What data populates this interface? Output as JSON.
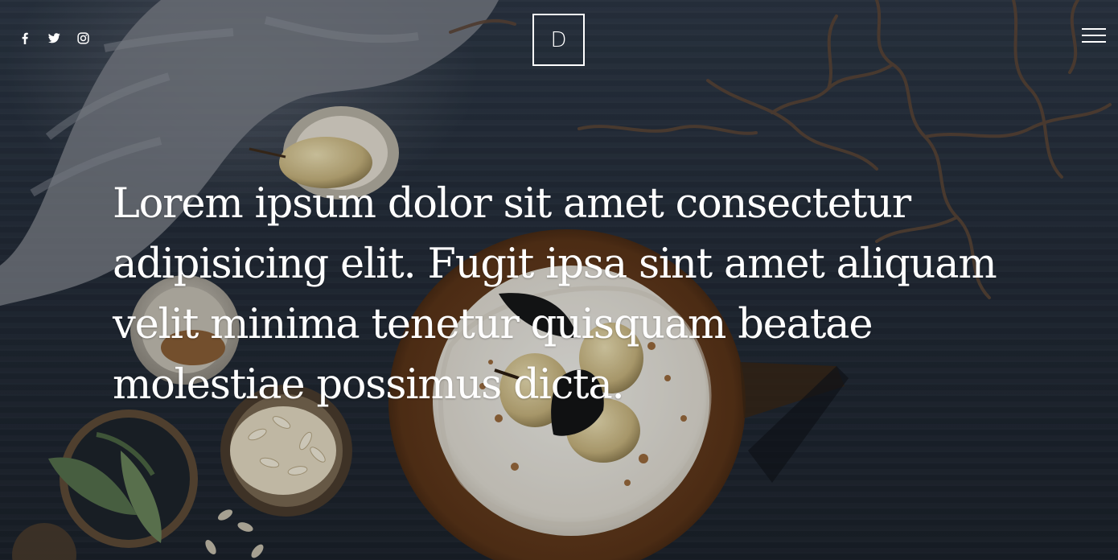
{
  "header": {
    "social_links": [
      {
        "icon": "facebook-icon"
      },
      {
        "icon": "twitter-icon"
      },
      {
        "icon": "instagram-icon"
      }
    ],
    "logo_letter": "D",
    "menu_icon": "hamburger-menu-icon"
  },
  "hero": {
    "headline": "Lorem ipsum dolor sit amet consectetur adipisicing elit. Fugit ipsa sint amet aliquam velit minima tenetur quisquam beatae molestiae possimus dicta."
  },
  "colors": {
    "text": "#ffffff",
    "background": "#222a36"
  }
}
